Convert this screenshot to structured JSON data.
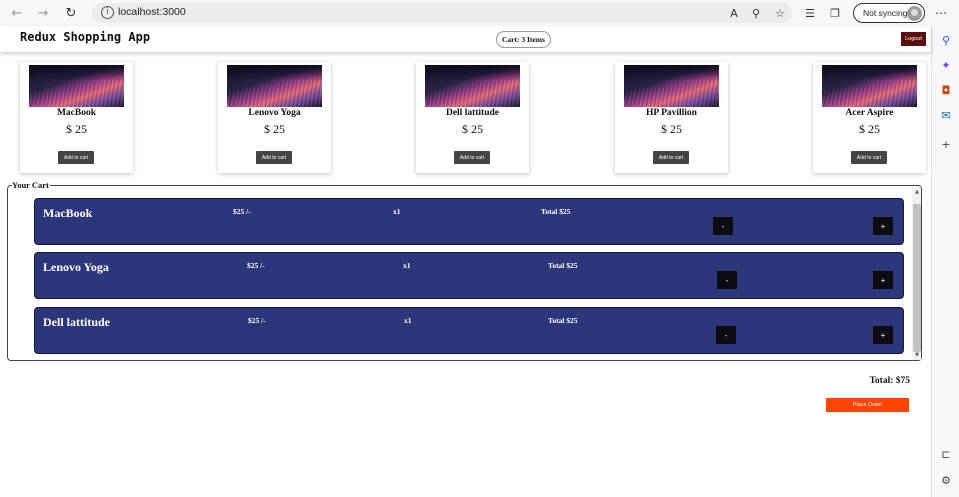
{
  "browser": {
    "url": "localhost:3000",
    "sync_label": "Not syncing"
  },
  "header": {
    "title": "Redux Shopping App",
    "cart_label": "Cart: 3 Items",
    "logout_label": "Logout"
  },
  "products": [
    {
      "name": "MacBook",
      "price": "$ 25",
      "button": "Add to cart"
    },
    {
      "name": "Lenovo Yoga",
      "price": "$ 25",
      "button": "Add to cart"
    },
    {
      "name": "Dell lattitude",
      "price": "$ 25",
      "button": "Add to cart"
    },
    {
      "name": "HP Pavillion",
      "price": "$ 25",
      "button": "Add to cart"
    },
    {
      "name": "Acer Aspire",
      "price": "$ 25",
      "button": "Add to cart"
    }
  ],
  "cart": {
    "legend": "Your Cart",
    "items": [
      {
        "name": "MacBook",
        "unit_price": "$25 /-",
        "qty": "x1",
        "total": "Total $25",
        "minus": "-",
        "plus": "+"
      },
      {
        "name": "Lenovo Yoga",
        "unit_price": "$25 /-",
        "qty": "x1",
        "total": "Total $25",
        "minus": "-",
        "plus": "+"
      },
      {
        "name": "Dell lattitude",
        "unit_price": "$25 /-",
        "qty": "x1",
        "total": "Total $25",
        "minus": "-",
        "plus": "+"
      }
    ],
    "grand_total": "Total: $75",
    "place_order_label": "Place Order"
  },
  "colors": {
    "cart_item_bg": "#2c367a",
    "place_order": "#ff4500",
    "logout": "#5c0e0e"
  }
}
